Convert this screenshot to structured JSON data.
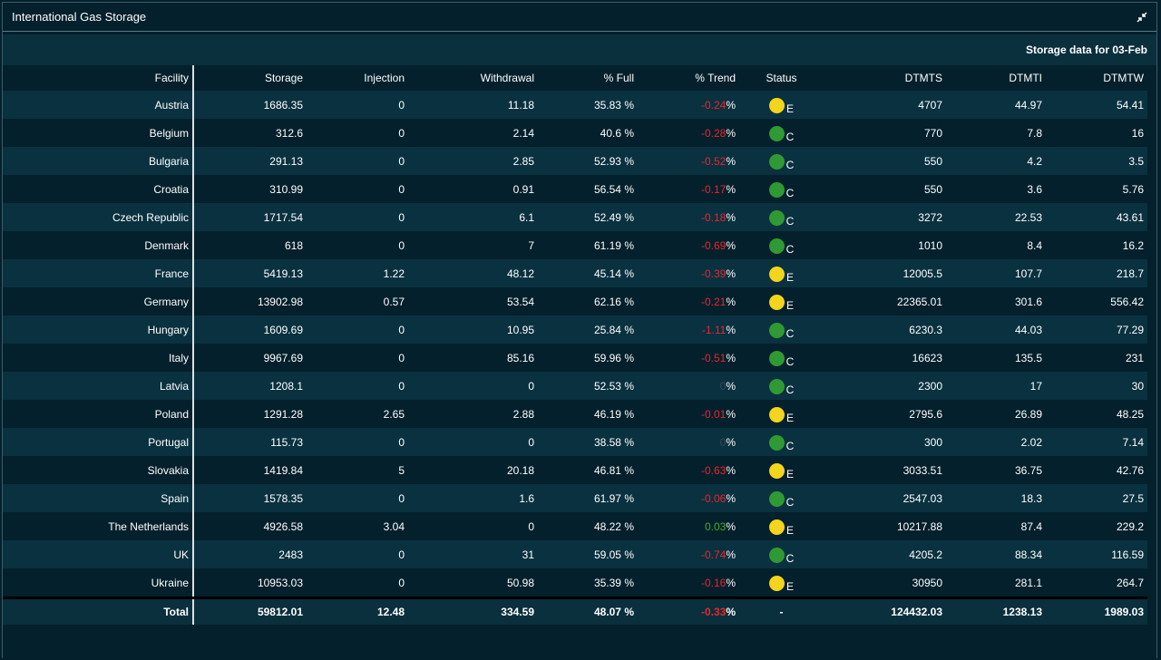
{
  "window": {
    "title": "International Gas Storage"
  },
  "subheader": "Storage data for 03-Feb",
  "columns": [
    "Facility",
    "Storage",
    "Injection",
    "Withdrawal",
    "% Full",
    "% Trend",
    "Status",
    "DTMTS",
    "DTMTI",
    "DTMTW"
  ],
  "rows": [
    {
      "facility": "Austria",
      "storage": "1686.35",
      "injection": "0",
      "withdrawal": "11.18",
      "full": "35.83 %",
      "trend": "-0.24",
      "status": "yellow",
      "status_letter": "E",
      "dtmts": "4707",
      "dtmti": "44.97",
      "dtmtw": "54.41"
    },
    {
      "facility": "Belgium",
      "storage": "312.6",
      "injection": "0",
      "withdrawal": "2.14",
      "full": "40.6 %",
      "trend": "-0.28",
      "status": "green",
      "status_letter": "C",
      "dtmts": "770",
      "dtmti": "7.8",
      "dtmtw": "16"
    },
    {
      "facility": "Bulgaria",
      "storage": "291.13",
      "injection": "0",
      "withdrawal": "2.85",
      "full": "52.93 %",
      "trend": "-0.52",
      "status": "green",
      "status_letter": "C",
      "dtmts": "550",
      "dtmti": "4.2",
      "dtmtw": "3.5"
    },
    {
      "facility": "Croatia",
      "storage": "310.99",
      "injection": "0",
      "withdrawal": "0.91",
      "full": "56.54 %",
      "trend": "-0.17",
      "status": "green",
      "status_letter": "C",
      "dtmts": "550",
      "dtmti": "3.6",
      "dtmtw": "5.76"
    },
    {
      "facility": "Czech Republic",
      "storage": "1717.54",
      "injection": "0",
      "withdrawal": "6.1",
      "full": "52.49 %",
      "trend": "-0.18",
      "status": "green",
      "status_letter": "C",
      "dtmts": "3272",
      "dtmti": "22.53",
      "dtmtw": "43.61"
    },
    {
      "facility": "Denmark",
      "storage": "618",
      "injection": "0",
      "withdrawal": "7",
      "full": "61.19 %",
      "trend": "-0.69",
      "status": "green",
      "status_letter": "C",
      "dtmts": "1010",
      "dtmti": "8.4",
      "dtmtw": "16.2"
    },
    {
      "facility": "France",
      "storage": "5419.13",
      "injection": "1.22",
      "withdrawal": "48.12",
      "full": "45.14 %",
      "trend": "-0.39",
      "status": "yellow",
      "status_letter": "E",
      "dtmts": "12005.5",
      "dtmti": "107.7",
      "dtmtw": "218.7"
    },
    {
      "facility": "Germany",
      "storage": "13902.98",
      "injection": "0.57",
      "withdrawal": "53.54",
      "full": "62.16 %",
      "trend": "-0.21",
      "status": "yellow",
      "status_letter": "E",
      "dtmts": "22365.01",
      "dtmti": "301.6",
      "dtmtw": "556.42"
    },
    {
      "facility": "Hungary",
      "storage": "1609.69",
      "injection": "0",
      "withdrawal": "10.95",
      "full": "25.84 %",
      "trend": "-1.11",
      "status": "green",
      "status_letter": "C",
      "dtmts": "6230.3",
      "dtmti": "44.03",
      "dtmtw": "77.29"
    },
    {
      "facility": "Italy",
      "storage": "9967.69",
      "injection": "0",
      "withdrawal": "85.16",
      "full": "59.96 %",
      "trend": "-0.51",
      "status": "green",
      "status_letter": "C",
      "dtmts": "16623",
      "dtmti": "135.5",
      "dtmtw": "231"
    },
    {
      "facility": "Latvia",
      "storage": "1208.1",
      "injection": "0",
      "withdrawal": "0",
      "full": "52.53 %",
      "trend": "0",
      "status": "green",
      "status_letter": "C",
      "dtmts": "2300",
      "dtmti": "17",
      "dtmtw": "30"
    },
    {
      "facility": "Poland",
      "storage": "1291.28",
      "injection": "2.65",
      "withdrawal": "2.88",
      "full": "46.19 %",
      "trend": "-0.01",
      "status": "yellow",
      "status_letter": "E",
      "dtmts": "2795.6",
      "dtmti": "26.89",
      "dtmtw": "48.25"
    },
    {
      "facility": "Portugal",
      "storage": "115.73",
      "injection": "0",
      "withdrawal": "0",
      "full": "38.58 %",
      "trend": "0",
      "status": "green",
      "status_letter": "C",
      "dtmts": "300",
      "dtmti": "2.02",
      "dtmtw": "7.14"
    },
    {
      "facility": "Slovakia",
      "storage": "1419.84",
      "injection": "5",
      "withdrawal": "20.18",
      "full": "46.81 %",
      "trend": "-0.63",
      "status": "yellow",
      "status_letter": "E",
      "dtmts": "3033.51",
      "dtmti": "36.75",
      "dtmtw": "42.76"
    },
    {
      "facility": "Spain",
      "storage": "1578.35",
      "injection": "0",
      "withdrawal": "1.6",
      "full": "61.97 %",
      "trend": "-0.06",
      "status": "green",
      "status_letter": "C",
      "dtmts": "2547.03",
      "dtmti": "18.3",
      "dtmtw": "27.5"
    },
    {
      "facility": "The Netherlands",
      "storage": "4926.58",
      "injection": "3.04",
      "withdrawal": "0",
      "full": "48.22 %",
      "trend": "0.03",
      "status": "yellow",
      "status_letter": "E",
      "dtmts": "10217.88",
      "dtmti": "87.4",
      "dtmtw": "229.2"
    },
    {
      "facility": "UK",
      "storage": "2483",
      "injection": "0",
      "withdrawal": "31",
      "full": "59.05 %",
      "trend": "-0.74",
      "status": "green",
      "status_letter": "C",
      "dtmts": "4205.2",
      "dtmti": "88.34",
      "dtmtw": "116.59"
    },
    {
      "facility": "Ukraine",
      "storage": "10953.03",
      "injection": "0",
      "withdrawal": "50.98",
      "full": "35.39 %",
      "trend": "-0.16",
      "status": "yellow",
      "status_letter": "E",
      "dtmts": "30950",
      "dtmti": "281.1",
      "dtmtw": "264.7"
    }
  ],
  "total": {
    "facility": "Total",
    "storage": "59812.01",
    "injection": "12.48",
    "withdrawal": "334.59",
    "full": "48.07 %",
    "trend": "-0.33",
    "status": "-",
    "dtmts": "124432.03",
    "dtmti": "1238.13",
    "dtmtw": "1989.03"
  },
  "trend_unit": "%",
  "colors": {
    "background": "#03202c",
    "row_alt": "#0a3140",
    "negative": "#e8262e",
    "positive": "#3fae2a",
    "status_yellow": "#f4d41c",
    "status_green": "#2f9a33"
  }
}
